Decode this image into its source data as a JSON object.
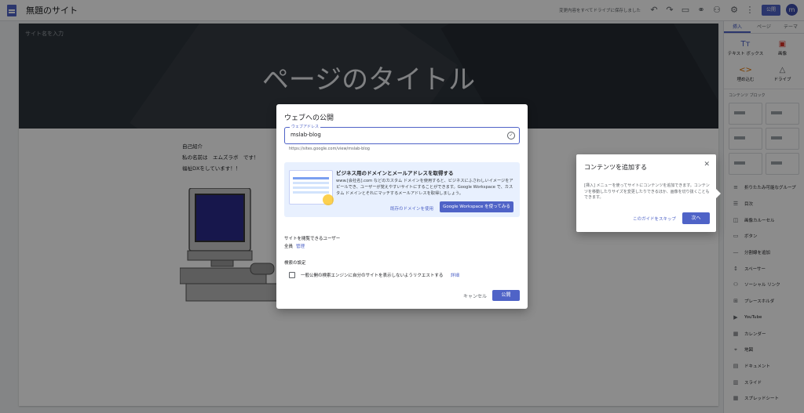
{
  "topbar": {
    "site_title": "無題のサイト",
    "saved_status": "変更内容をすべてドライブに保存しました",
    "publish_label": "公開",
    "avatar_initial": "m"
  },
  "canvas": {
    "site_name_placeholder": "サイト名を入力",
    "page_title": "ページのタイトル",
    "intro_lines": [
      "自己紹介",
      "私の名前は　エムズラボ　です！",
      "福祉DXをしています！！"
    ]
  },
  "sidebar": {
    "tabs": [
      "挿入",
      "ページ",
      "テーマ"
    ],
    "insert_items": [
      {
        "label": "テキスト ボックス",
        "icon": "Tт"
      },
      {
        "label": "画像",
        "icon": "▣"
      },
      {
        "label": "埋め込む",
        "icon": "<>"
      },
      {
        "label": "ドライブ",
        "icon": "△"
      }
    ],
    "blocks_label": "コンテンツ ブロック",
    "components": [
      {
        "label": "折りたたみ可能なグループ",
        "icon": "≡"
      },
      {
        "label": "目次",
        "icon": "☰"
      },
      {
        "label": "画像カルーセル",
        "icon": "◫"
      },
      {
        "label": "ボタン",
        "icon": "▭"
      },
      {
        "label": "分割線を追加",
        "icon": "—"
      },
      {
        "label": "スペーサー",
        "icon": "↕"
      },
      {
        "label": "ソーシャル リンク",
        "icon": "⚇"
      },
      {
        "label": "プレースホルダ",
        "icon": "⊞"
      },
      {
        "label": "YouTube",
        "icon": "▶"
      },
      {
        "label": "カレンダー",
        "icon": "▦"
      },
      {
        "label": "地図",
        "icon": "⌖"
      },
      {
        "label": "ドキュメント",
        "icon": "▤"
      },
      {
        "label": "スライド",
        "icon": "▥"
      },
      {
        "label": "スプレッドシート",
        "icon": "▦"
      }
    ]
  },
  "publish_dialog": {
    "title": "ウェブへの公開",
    "address_label": "ウェブアドレス",
    "address_value": "mslab-blog",
    "address_url": "https://sites.google.com/view/mslab-blog",
    "promo_title": "ビジネス用のドメインとメールアドレスを取得する",
    "promo_text": "www.[会社名].com などのカスタム ドメインを使用すると、ビジネスにふさわしいイメージをアピールでき、ユーザーが覚えやすいサイトにすることができます。Google Workspace で、カスタム ドメインとそれにマッチするメールアドレスを取得しましょう。",
    "promo_link": "既存のドメインを使用",
    "promo_button": "Google Workspace を使ってみる",
    "viewers_label": "サイトを閲覧できるユーザー",
    "viewers_value": "全員",
    "viewers_manage": "管理",
    "search_label": "検索の設定",
    "search_option": "一般公開の検索エンジンに自分のサイトを表示しないようリクエストする",
    "search_detail": "詳細",
    "cancel": "キャンセル",
    "publish": "公開"
  },
  "guide": {
    "title": "コンテンツを追加する",
    "text": "[挿入] メニューを使ってサイトにコンテンツを追加できます。コンテンツを移動したりサイズを変更したりできるほか、画像を切り抜くこともできます。",
    "skip": "このガイドをスキップ",
    "next": "次へ"
  }
}
